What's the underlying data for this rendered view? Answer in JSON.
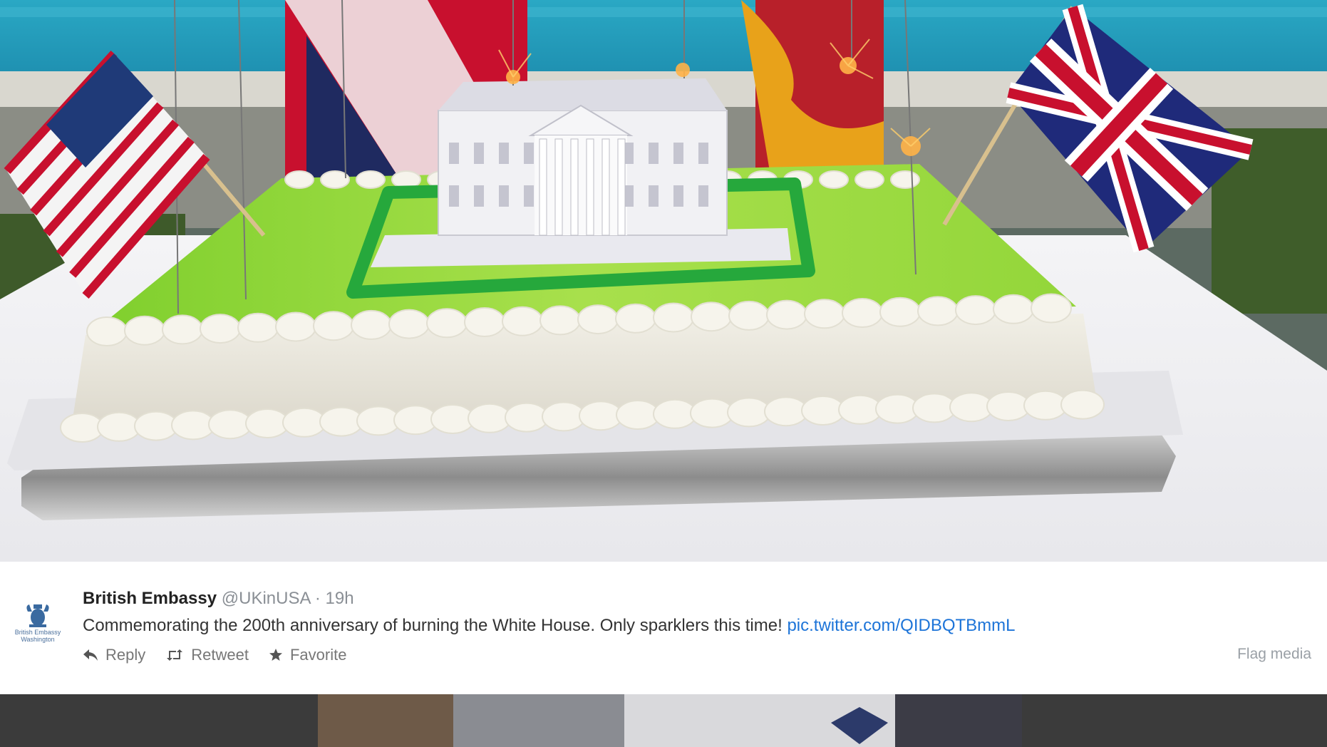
{
  "tweet": {
    "name": "British Embassy",
    "handle": "@UKinUSA",
    "separator": "·",
    "time": "19h",
    "text": "Commemorating the 200th anniversary of burning the White House. Only sparklers this time!",
    "link": "pic.twitter.com/QIDBQTBmmL",
    "actions": {
      "reply": "Reply",
      "retweet": "Retweet",
      "favorite": "Favorite"
    },
    "flag_media": "Flag media"
  },
  "logo": {
    "line1": "British Embassy",
    "line2": "Washington"
  },
  "icons": {
    "reply": "reply-icon",
    "retweet": "retweet-icon",
    "favorite": "star-icon",
    "crest": "royal-crest-icon"
  },
  "colors": {
    "link": "#1d74d8",
    "pool": "#1fa5bd",
    "cake_top": "#8fd93c",
    "frosting": "#f3f1ea"
  }
}
